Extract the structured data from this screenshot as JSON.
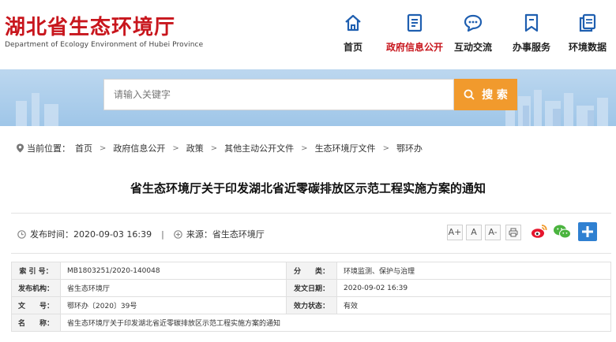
{
  "header": {
    "site_title_cn": "湖北省生态环境厅",
    "site_title_en": "Department of Ecology Environment of Hubei Province",
    "brand_color": "#c8161d",
    "nav": [
      {
        "label": "首页",
        "icon": "home-icon"
      },
      {
        "label": "政府信息公开",
        "icon": "document-icon",
        "active": true
      },
      {
        "label": "互动交流",
        "icon": "chat-icon"
      },
      {
        "label": "办事服务",
        "icon": "bookmark-icon"
      },
      {
        "label": "环境数据",
        "icon": "copy-icon"
      }
    ]
  },
  "search": {
    "placeholder": "请输入关键字",
    "button_label": "搜  索",
    "button_color": "#f19a2d"
  },
  "breadcrumb": {
    "prefix": "当前位置：",
    "items": [
      "首页",
      "政府信息公开",
      "政策",
      "其他主动公开文件",
      "生态环境厅文件",
      "鄂环办"
    ]
  },
  "article": {
    "title": "省生态环境厅关于印发湖北省近零碳排放区示范工程实施方案的通知",
    "publish_time": "发布时间：2020-09-03 16:39",
    "separator": "|",
    "source": "来源：省生态环境厅",
    "font_sizes": [
      "A+",
      "A",
      "A-"
    ]
  },
  "info_table": {
    "rows": [
      {
        "k1": "索 引 号：",
        "v1": "MB1803251/2020-140048",
        "k2": "分　　类：",
        "v2": "环境监测、保护与治理"
      },
      {
        "k1": "发布机构：",
        "v1": "省生态环境厅",
        "k2": "发文日期：",
        "v2": "2020-09-02 16:39"
      },
      {
        "k1": "文　　号：",
        "v1": "鄂环办〔2020〕39号",
        "k2": "效力状态：",
        "v2": "有效"
      }
    ],
    "name_label": "名　　称：",
    "name_value": "省生态环境厅关于印发湖北省近零碳排放区示范工程实施方案的通知"
  }
}
